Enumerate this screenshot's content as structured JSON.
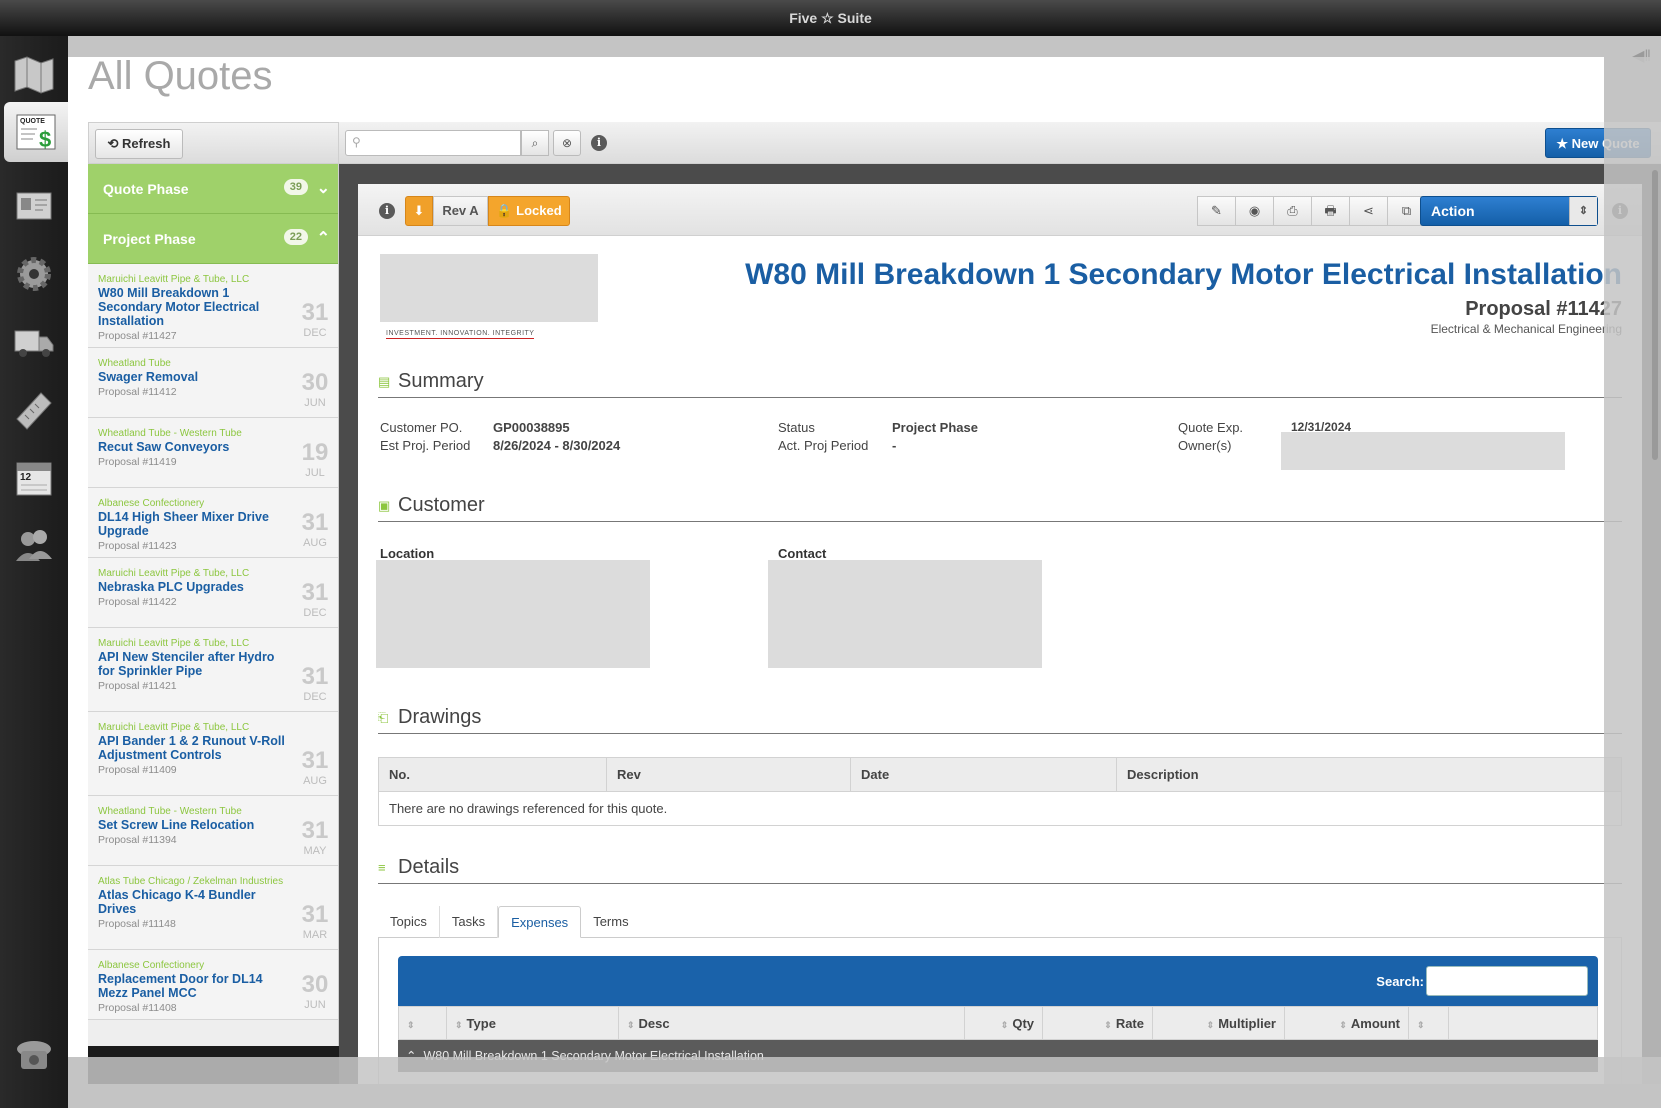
{
  "app": {
    "title": "Five ☆ Suite"
  },
  "page": {
    "title": "All Quotes"
  },
  "nav": [
    {
      "name": "map-nav-icon"
    },
    {
      "name": "quote-nav-icon",
      "label": "QUOTE"
    },
    {
      "name": "contacts-nav-icon"
    },
    {
      "name": "settings-nav-icon"
    },
    {
      "name": "truck-nav-icon"
    },
    {
      "name": "ruler-nav-icon"
    },
    {
      "name": "calendar-nav-icon",
      "label": "12"
    },
    {
      "name": "users-nav-icon"
    },
    {
      "name": "phone-nav-icon"
    }
  ],
  "toolbar": {
    "refresh_label": "⟲ Refresh",
    "search_placeholder": "",
    "new_quote_label": "★ New Quote"
  },
  "phases": [
    {
      "label": "Quote Phase",
      "count": "39",
      "chevron": "⌄"
    },
    {
      "label": "Project Phase",
      "count": "22",
      "chevron": "⌃"
    }
  ],
  "quotes": [
    {
      "customer": "Maruichi Leavitt Pipe & Tube, LLC",
      "title": "W80 Mill Breakdown 1 Secondary Motor Electrical Installation",
      "proposal": "Proposal #11427",
      "day": "31",
      "month": "DEC"
    },
    {
      "customer": "Wheatland Tube",
      "title": "Swager Removal",
      "proposal": "Proposal #11412",
      "day": "30",
      "month": "JUN"
    },
    {
      "customer": "Wheatland Tube - Western Tube",
      "title": "Recut Saw Conveyors",
      "proposal": "Proposal #11419",
      "day": "19",
      "month": "JUL"
    },
    {
      "customer": "Albanese Confectionery",
      "title": "DL14 High Sheer Mixer Drive Upgrade",
      "proposal": "Proposal #11423",
      "day": "31",
      "month": "AUG"
    },
    {
      "customer": "Maruichi Leavitt Pipe & Tube, LLC",
      "title": "Nebraska PLC Upgrades",
      "proposal": "Proposal #11422",
      "day": "31",
      "month": "DEC"
    },
    {
      "customer": "Maruichi Leavitt Pipe & Tube, LLC",
      "title": "API New Stenciler after Hydro for Sprinkler Pipe",
      "proposal": "Proposal #11421",
      "day": "31",
      "month": "DEC"
    },
    {
      "customer": "Maruichi Leavitt Pipe & Tube, LLC",
      "title": "API Bander 1 & 2 Runout V-Roll Adjustment Controls",
      "proposal": "Proposal #11409",
      "day": "31",
      "month": "AUG"
    },
    {
      "customer": "Wheatland Tube - Western Tube",
      "title": "Set Screw Line Relocation",
      "proposal": "Proposal #11394",
      "day": "31",
      "month": "MAY"
    },
    {
      "customer": "Atlas Tube Chicago / Zekelman Industries",
      "title": "Atlas Chicago K-4 Bundler Drives",
      "proposal": "Proposal #11148",
      "day": "31",
      "month": "MAR"
    },
    {
      "customer": "Albanese Confectionery",
      "title": "Replacement Door for DL14 Mezz Panel MCC",
      "proposal": "Proposal #11408",
      "day": "30",
      "month": "JUN"
    }
  ],
  "doc": {
    "rev_label": "Rev A",
    "locked_label": "Locked",
    "action_label": "Action",
    "logo_tagline": "INVESTMENT. INNOVATION. INTEGRITY",
    "title": "W80 Mill Breakdown 1 Secondary Motor Electrical Installation",
    "proposal": "Proposal #11427",
    "subtitle": "Electrical & Mechanical Engineering",
    "summary": {
      "heading": "Summary",
      "customer_po_label": "Customer PO.",
      "customer_po": "GP00038895",
      "est_period_label": "Est Proj. Period",
      "est_period": "8/26/2024 - 8/30/2024",
      "status_label": "Status",
      "status": "Project Phase",
      "act_period_label": "Act. Proj Period",
      "act_period": "-",
      "quote_exp_label": "Quote Exp.",
      "quote_exp": "12/31/2024",
      "owners_label": "Owner(s)"
    },
    "customer": {
      "heading": "Customer",
      "location_label": "Location",
      "contact_label": "Contact"
    },
    "drawings": {
      "heading": "Drawings",
      "columns": [
        "No.",
        "Rev",
        "Date",
        "Description"
      ],
      "empty": "There are no drawings referenced for this quote."
    },
    "details": {
      "heading": "Details",
      "tabs": [
        "Topics",
        "Tasks",
        "Expenses",
        "Terms"
      ],
      "active_tab": "Expenses",
      "search_label": "Search:",
      "columns": [
        "",
        "Type",
        "Desc",
        "Qty",
        "Rate",
        "Multiplier",
        "Amount",
        ""
      ],
      "group_row": "W80 Mill Breakdown 1 Secondary Motor Electrical Installation"
    }
  },
  "colors": {
    "accent": "#1a5ea3",
    "phase_green": "#9fd16a",
    "orange": "#f4a52c"
  }
}
